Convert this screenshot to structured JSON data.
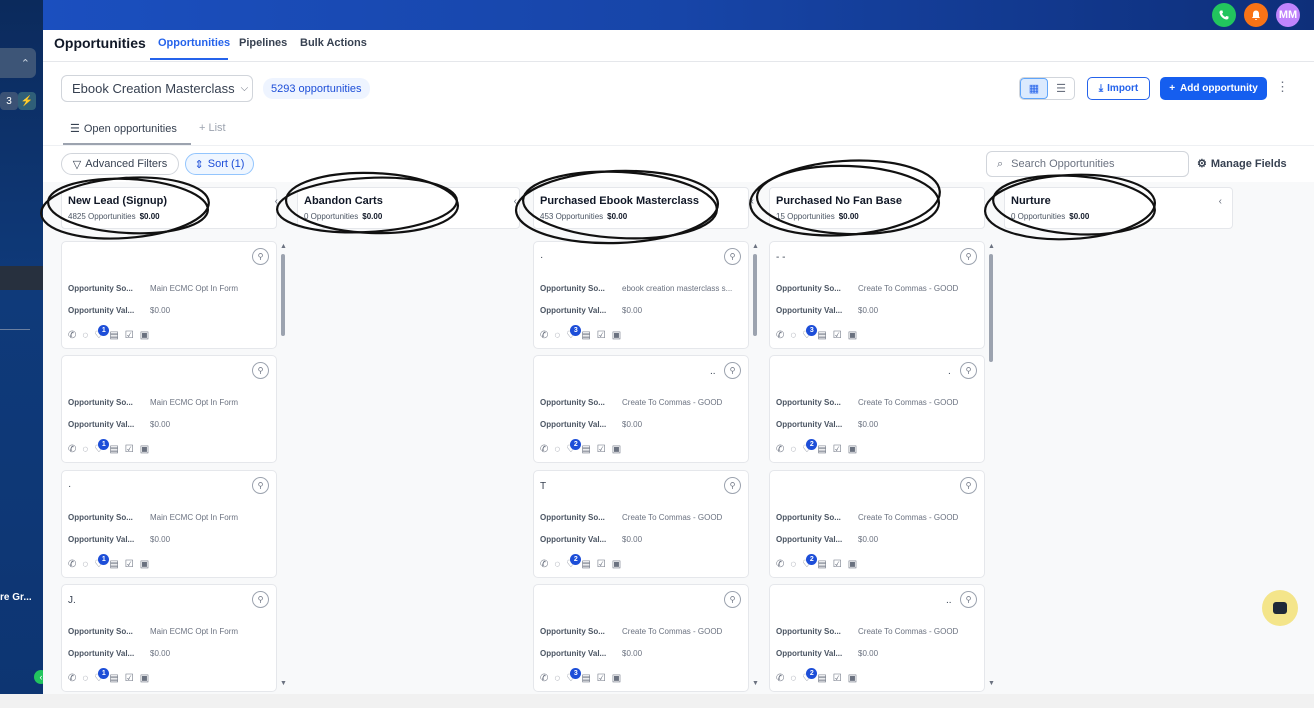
{
  "sidebar": {
    "select_icon": "⌃",
    "chip_a": "3",
    "chip_b": "⚡",
    "footer_text": "re Gr...",
    "collapse_icon": "‹"
  },
  "topbar": {
    "avatar_initials": "MM",
    "colors": {
      "phone": "#22c55e",
      "bell": "#f97316",
      "avatar": "#c084fc"
    }
  },
  "header": {
    "title": "Opportunities",
    "tabs": [
      {
        "label": "Opportunities",
        "active": true
      },
      {
        "label": "Pipelines",
        "active": false
      },
      {
        "label": "Bulk Actions",
        "active": false
      }
    ]
  },
  "toolbar": {
    "pipeline": "Ebook Creation Masterclass",
    "opportunity_count": "5293 opportunities",
    "import_label": "Import",
    "add_label": "Add opportunity",
    "subtabs": {
      "open": "Open opportunities",
      "list": "+ List"
    },
    "advanced_filters": "Advanced Filters",
    "sort": "Sort (1)",
    "search_placeholder": "Search Opportunities",
    "manage_fields": "Manage Fields"
  },
  "stages": [
    {
      "name": "New Lead (Signup)",
      "count": "4825 Opportunities",
      "value": "$0.00"
    },
    {
      "name": "Abandon Carts",
      "count": "0 Opportunities",
      "value": "$0.00"
    },
    {
      "name": "Purchased Ebook Masterclass",
      "count": "453 Opportunities",
      "value": "$0.00"
    },
    {
      "name": "Purchased No Fan Base",
      "count": "15 Opportunities",
      "value": "$0.00"
    },
    {
      "name": "Nurture",
      "count": "0 Opportunities",
      "value": "$0.00"
    }
  ],
  "labels": {
    "source": "Opportunity So...",
    "value": "Opportunity Val..."
  },
  "columns": {
    "new_lead": [
      {
        "name": "",
        "source": "Main ECMC Opt In Form",
        "value": "$0.00",
        "badge": "1"
      },
      {
        "name": "",
        "source": "Main ECMC Opt In Form",
        "value": "$0.00",
        "badge": "1"
      },
      {
        "name": "·",
        "source": "Main ECMC Opt In Form",
        "value": "$0.00",
        "badge": "1"
      },
      {
        "name": "J.",
        "source": "Main ECMC Opt In Form",
        "value": "$0.00",
        "badge": "1"
      }
    ],
    "purchased_ebook": [
      {
        "name": "·",
        "source": "ebook creation masterclass s...",
        "value": "$0.00",
        "badge": "3"
      },
      {
        "name": "..",
        "source": "Create To Commas - GOOD",
        "value": "$0.00",
        "badge": "2"
      },
      {
        "name": "T",
        "source": "Create To Commas - GOOD",
        "value": "$0.00",
        "badge": "2"
      },
      {
        "name": "",
        "source": "Create To Commas - GOOD",
        "value": "$0.00",
        "badge": "3"
      }
    ],
    "purchased_no_fan": [
      {
        "name": "- -",
        "source": "Create To Commas - GOOD",
        "value": "$0.00",
        "badge": "3"
      },
      {
        "name": ".",
        "source": "Create To Commas - GOOD",
        "value": "$0.00",
        "badge": "2"
      },
      {
        "name": "",
        "source": "Create To Commas - GOOD",
        "value": "$0.00",
        "badge": "2"
      },
      {
        "name": "..",
        "source": "Create To Commas - GOOD",
        "value": "$0.00",
        "badge": "2"
      }
    ]
  }
}
